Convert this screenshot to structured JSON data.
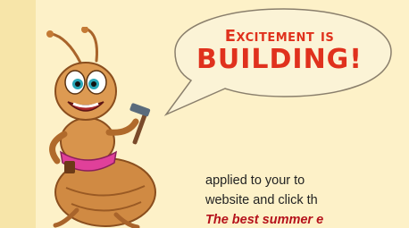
{
  "speech_bubble": {
    "line1": "Excitement is",
    "line2": "building!"
  },
  "body": {
    "line1": "applied to your to",
    "line2": "website and click th"
  },
  "promo": {
    "text": "The best summer e"
  },
  "colors": {
    "background": "#fdf1c8",
    "bubble_fill": "#fbf3d6",
    "bubble_outline": "#8a7f6c",
    "headline": "#e0311d",
    "promo": "#b5121b"
  },
  "icons": [
    "ant-mascot",
    "hammer-icon",
    "tool-belt"
  ]
}
